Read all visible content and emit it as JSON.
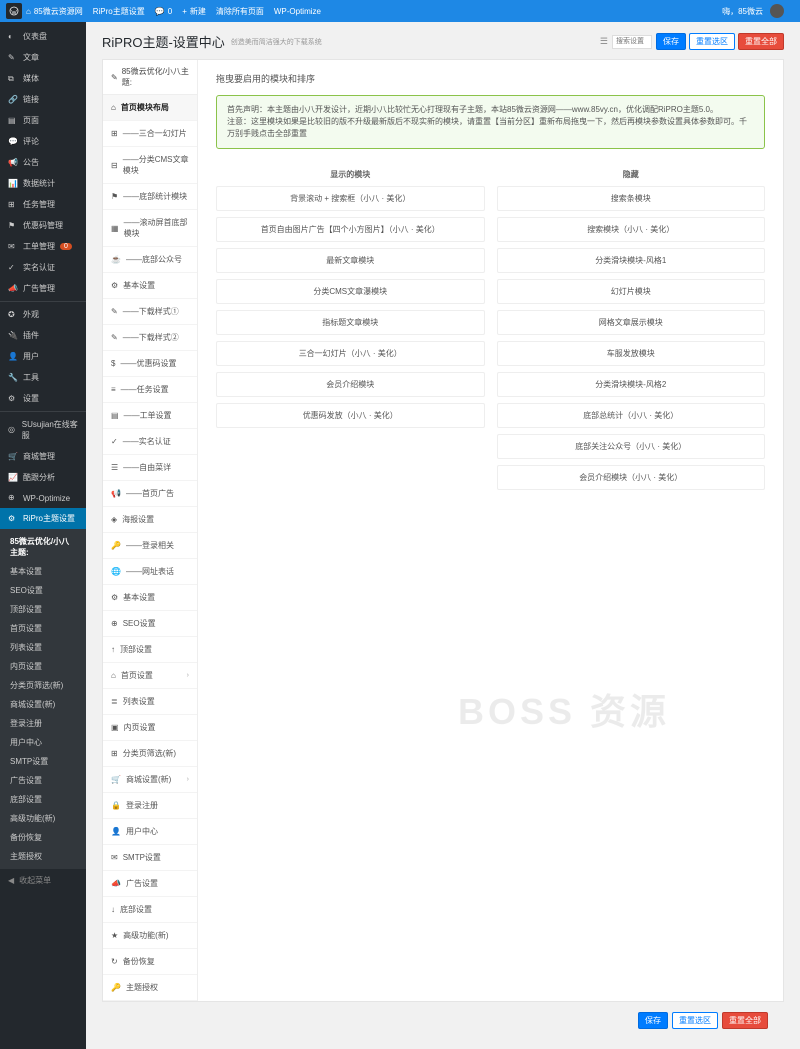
{
  "topbar": {
    "site": "85微云资源网",
    "theme": "RiPro主题设置",
    "comments": "0",
    "new": "新建",
    "clear": "清除所有页面",
    "wpopt": "WP-Optimize",
    "greeting": "嗨，85微云"
  },
  "sidebar": {
    "items": [
      {
        "icon": "◐",
        "label": "仪表盘"
      },
      {
        "icon": "✎",
        "label": "文章"
      },
      {
        "icon": "⧉",
        "label": "媒体"
      },
      {
        "icon": "🔗",
        "label": "链接"
      },
      {
        "icon": "▤",
        "label": "页面"
      },
      {
        "icon": "💬",
        "label": "评论"
      },
      {
        "icon": "📢",
        "label": "公告"
      },
      {
        "icon": "📊",
        "label": "数据统计"
      },
      {
        "icon": "⊞",
        "label": "任务管理"
      },
      {
        "icon": "⚑",
        "label": "优惠码管理"
      },
      {
        "icon": "✉",
        "label": "工单管理",
        "badge": "0"
      },
      {
        "icon": "✓",
        "label": "实名认证"
      },
      {
        "icon": "📣",
        "label": "广告管理"
      },
      {
        "icon": "✪",
        "label": "外观",
        "sep": true
      },
      {
        "icon": "🔌",
        "label": "插件"
      },
      {
        "icon": "👤",
        "label": "用户"
      },
      {
        "icon": "🔧",
        "label": "工具"
      },
      {
        "icon": "⚙",
        "label": "设置"
      },
      {
        "icon": "◎",
        "label": "SUsujian在线客服",
        "sep": true
      },
      {
        "icon": "🛒",
        "label": "商城管理"
      },
      {
        "icon": "📈",
        "label": "酷跟分析"
      },
      {
        "icon": "⊕",
        "label": "WP-Optimize"
      },
      {
        "icon": "⚙",
        "label": "RiPro主题设置",
        "active": true
      }
    ],
    "sub": [
      {
        "label": "85微云优化/小八主题:",
        "active": true
      },
      {
        "label": "基本设置"
      },
      {
        "label": "SEO设置"
      },
      {
        "label": "顶部设置"
      },
      {
        "label": "首页设置"
      },
      {
        "label": "列表设置"
      },
      {
        "label": "内页设置"
      },
      {
        "label": "分类页筛选(新)"
      },
      {
        "label": "商城设置(新)"
      },
      {
        "label": "登录注册"
      },
      {
        "label": "用户中心"
      },
      {
        "label": "SMTP设置"
      },
      {
        "label": "广告设置"
      },
      {
        "label": "底部设置"
      },
      {
        "label": "高级功能(新)"
      },
      {
        "label": "备份恢复"
      },
      {
        "label": "主题授权"
      }
    ],
    "collapse": "收起菜单"
  },
  "page": {
    "title": "RiPRO主题-设置中心",
    "desc": "创造美而简洁强大的下载系统",
    "search_placeholder": "搜索设置",
    "btn_save": "保存",
    "btn_reset_section": "重置选区",
    "btn_reset_all": "重置全部"
  },
  "menu2": {
    "head": "85微云优化/小八主题:",
    "items": [
      {
        "icon": "⌂",
        "label": "首页模块布局",
        "active": true
      },
      {
        "icon": "⊞",
        "label": "——三合一幻灯片"
      },
      {
        "icon": "⊟",
        "label": "——分类CMS文章模块"
      },
      {
        "icon": "⚑",
        "label": "——底部统计模块"
      },
      {
        "icon": "▦",
        "label": "——滚动屏首底部模块"
      },
      {
        "icon": "☕",
        "label": "——底部公众号"
      },
      {
        "icon": "⚙",
        "label": "基本设置"
      },
      {
        "icon": "✎",
        "label": "——下载样式①"
      },
      {
        "icon": "✎",
        "label": "——下载样式②"
      },
      {
        "icon": "$",
        "label": "——优惠码设置"
      },
      {
        "icon": "≡",
        "label": "——任务设置"
      },
      {
        "icon": "▤",
        "label": "——工单设置"
      },
      {
        "icon": "✓",
        "label": "——实名认证"
      },
      {
        "icon": "☰",
        "label": "——自由菜详"
      },
      {
        "icon": "📢",
        "label": "——首页广告"
      },
      {
        "icon": "◈",
        "label": "海报设置"
      },
      {
        "icon": "🔑",
        "label": "——登录相关"
      },
      {
        "icon": "🌐",
        "label": "——网址表话"
      },
      {
        "icon": "⚙",
        "label": "基本设置"
      },
      {
        "icon": "⊕",
        "label": "SEO设置"
      },
      {
        "icon": "↑",
        "label": "顶部设置"
      },
      {
        "icon": "⌂",
        "label": "首页设置",
        "chev": true
      },
      {
        "icon": "≣",
        "label": "列表设置"
      },
      {
        "icon": "▣",
        "label": "内页设置"
      },
      {
        "icon": "⊞",
        "label": "分类页筛选(新)"
      },
      {
        "icon": "🛒",
        "label": "商城设置(新)",
        "chev": true
      },
      {
        "icon": "🔒",
        "label": "登录注册"
      },
      {
        "icon": "👤",
        "label": "用户中心"
      },
      {
        "icon": "✉",
        "label": "SMTP设置"
      },
      {
        "icon": "📣",
        "label": "广告设置"
      },
      {
        "icon": "↓",
        "label": "底部设置"
      },
      {
        "icon": "★",
        "label": "高级功能(新)"
      },
      {
        "icon": "↻",
        "label": "备份恢复"
      },
      {
        "icon": "🔑",
        "label": "主题授权"
      }
    ]
  },
  "pane": {
    "title": "拖曳要启用的模块和排序",
    "notice_l1": "首先声明：本主题由小八开发设计，近期小八比较忙无心打理现有子主题，本站85微云资源网——www.85vy.cn，优化调配RiPRO主题5.0。",
    "notice_l2": "注意：这里模块如果是比较旧的版不升级最新版后不现实新的模块，请重置【当前分区】重新布局拖曳一下，然后再模块参数设置具体参数即可。千万别手贱点击全部重置",
    "col_show": "显示的模块",
    "col_hide": "隐藏",
    "show": [
      "背景滚动 + 搜索框（小八 · 美化）",
      "首页自由图片广告【四个小方图片】（小八 · 美化）",
      "最新文章模块",
      "分类CMS文章瀑模块",
      "指标题文章模块",
      "三合一幻灯片（小八 · 美化）",
      "会员介绍模块",
      "优惠码发放（小八 · 美化）"
    ],
    "hide": [
      "搜索条模块",
      "搜索模块（小八 · 美化）",
      "分类滑块模块-风格1",
      "幻灯片模块",
      "网格文章展示模块",
      "车服发放模块",
      "分类滑块模块-风格2",
      "底部总统计（小八 · 美化）",
      "底部关注公众号（小八 · 美化）",
      "会员介绍模块（小八 · 美化）"
    ]
  },
  "watermark": "BOSS 资源"
}
